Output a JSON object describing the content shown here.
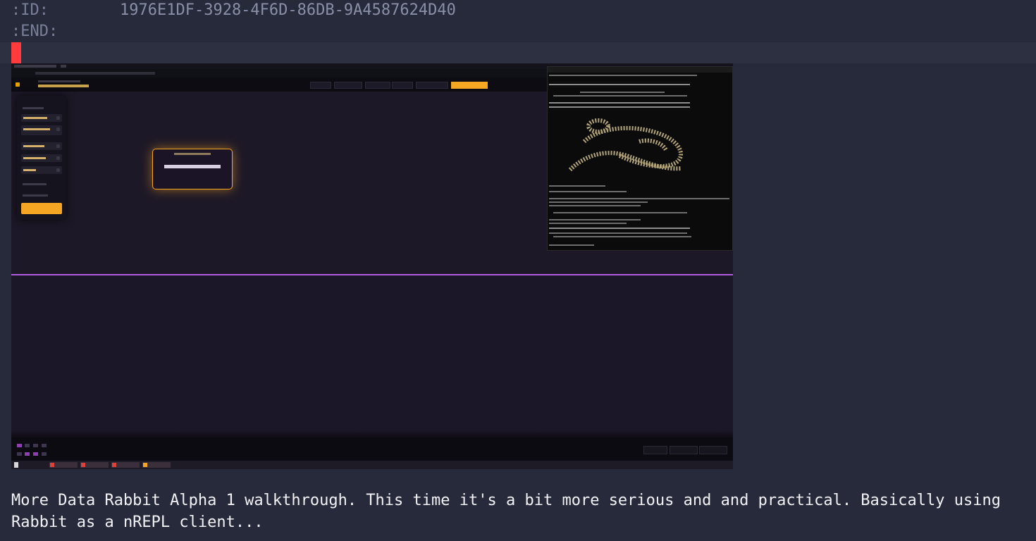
{
  "properties": {
    "id_key": ":ID:",
    "id_value": "1976E1DF-3928-4F6D-86DB-9A4587624D40",
    "end_key": ":END:"
  },
  "screenshot": {
    "description_icon": "embedded-screenshot-image",
    "accent_color": "#f5a623",
    "divider_color": "#b15ce0"
  },
  "caption": "More Data Rabbit Alpha 1 walkthrough. This time it's a bit more serious and and practical. Basically using Rabbit as a nREPL client...",
  "colors": {
    "background": "#262a3a",
    "cursor": "#ff3b3b",
    "property_text": "#7a7f99"
  }
}
